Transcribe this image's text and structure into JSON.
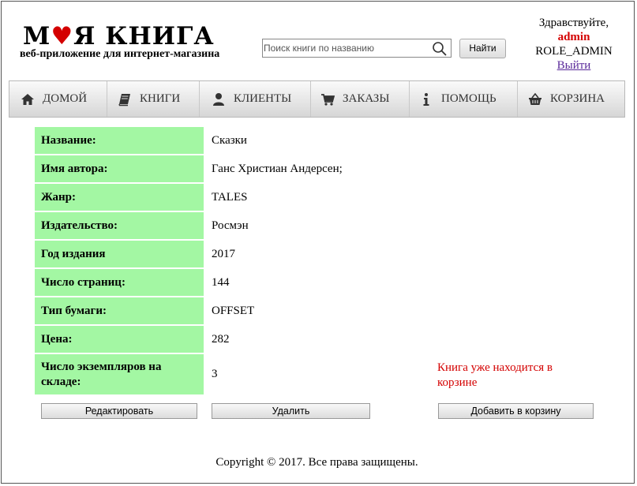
{
  "header": {
    "logo_left": "М",
    "logo_heart": "♥",
    "logo_right": "Я КНИГА",
    "subtitle": "веб-приложение для интернет-магазина",
    "search_placeholder": "Поиск книги по названию",
    "search_button": "Найти",
    "greeting": "Здравствуйте,",
    "username": "admin",
    "role": "ROLE_ADMIN",
    "logout": "Выйти"
  },
  "nav": [
    {
      "label": "ДОМОЙ",
      "icon": "home-icon"
    },
    {
      "label": "КНИГИ",
      "icon": "book-icon"
    },
    {
      "label": "КЛИЕНТЫ",
      "icon": "user-icon"
    },
    {
      "label": "ЗАКАЗЫ",
      "icon": "cart-icon"
    },
    {
      "label": "ПОМОЩЬ",
      "icon": "info-icon"
    },
    {
      "label": "КОРЗИНА",
      "icon": "basket-icon"
    }
  ],
  "book": {
    "rows": [
      {
        "label": "Название:",
        "value": "Сказки"
      },
      {
        "label": "Имя автора:",
        "value": "Ганс Христиан Андерсен;"
      },
      {
        "label": "Жанр:",
        "value": "TALES"
      },
      {
        "label": "Издательство:",
        "value": "Росмэн"
      },
      {
        "label": "Год издания",
        "value": "2017"
      },
      {
        "label": "Число страниц:",
        "value": "144"
      },
      {
        "label": "Тип бумаги:",
        "value": "OFFSET"
      },
      {
        "label": "Цена:",
        "value": "282"
      },
      {
        "label": "Число экземпляров на складе:",
        "value": "3"
      }
    ],
    "in_cart_message": "Книга уже находится в корзине"
  },
  "actions": {
    "edit": "Редактировать",
    "delete": "Удалить",
    "add_to_cart": "Добавить в корзину"
  },
  "footer": {
    "copyright": "Copyright © 2017. Все права защищены."
  },
  "colors": {
    "label_bg": "#a3f7a3",
    "accent_red": "#d40000",
    "logout_link": "#5a2a9a"
  }
}
